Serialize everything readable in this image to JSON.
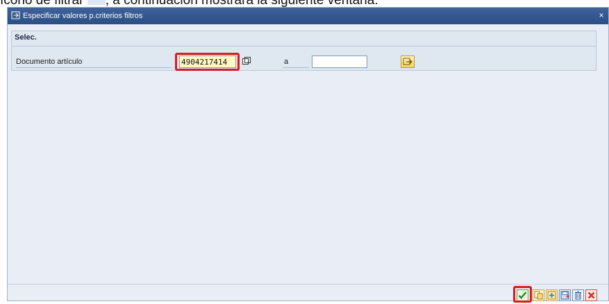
{
  "caption": {
    "left": "ícono de filtrar",
    "right": ", a continuación mostrará la siguiente ventana:"
  },
  "window": {
    "title": "Especificar valores p.criterios filtros",
    "close_glyph": "×"
  },
  "selection": {
    "group_title": "Selec.",
    "field_label": "Documento artículo",
    "from_value": "4904217414",
    "to_label": "a",
    "to_value": ""
  },
  "colors": {
    "title_bar": "#2b4e86",
    "highlight": "#e01818",
    "field_filled": "#fff9c2"
  },
  "toolbar": {
    "buttons": [
      "confirm-check-icon",
      "copy-icon",
      "add-criteria-icon",
      "save-variant-icon",
      "delete-icon",
      "cancel-icon"
    ]
  }
}
